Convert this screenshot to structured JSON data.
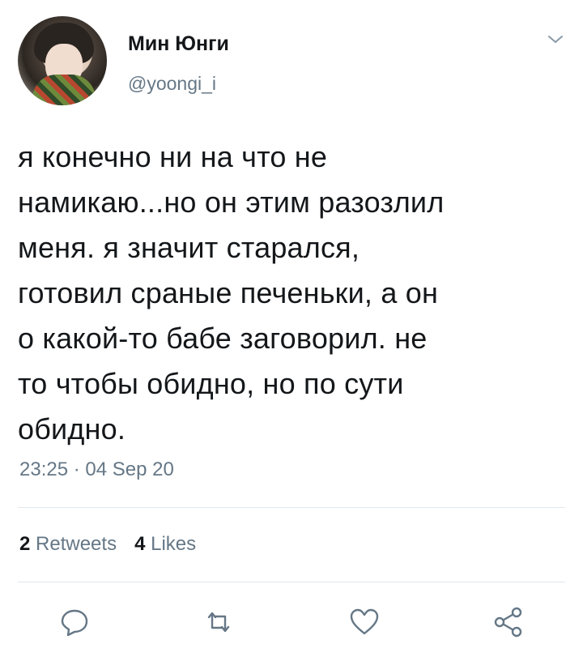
{
  "author": {
    "display_name": "Мин Юнги",
    "handle": "@yoongi_i"
  },
  "tweet": {
    "text": "я конечно ни на что не\nнамикаю...но он этим разозлил\nменя. я значит старался,\nготовил сраные печеньки, а он\nо какой-то бабе заговорил. не\nто чтобы обидно, но по сути\nобидно.",
    "timestamp": "23:25 · 04 Sep 20"
  },
  "stats": {
    "retweets_count": "2",
    "retweets_label": "Retweets",
    "likes_count": "4",
    "likes_label": "Likes"
  },
  "icons": {
    "menu": "chevron-down-icon",
    "reply": "reply-icon",
    "retweet": "retweet-icon",
    "like": "heart-icon",
    "share": "share-icon"
  },
  "colors": {
    "text": "#14171a",
    "secondary": "#657786",
    "icon": "#657786",
    "divider": "#e1e8ed"
  }
}
